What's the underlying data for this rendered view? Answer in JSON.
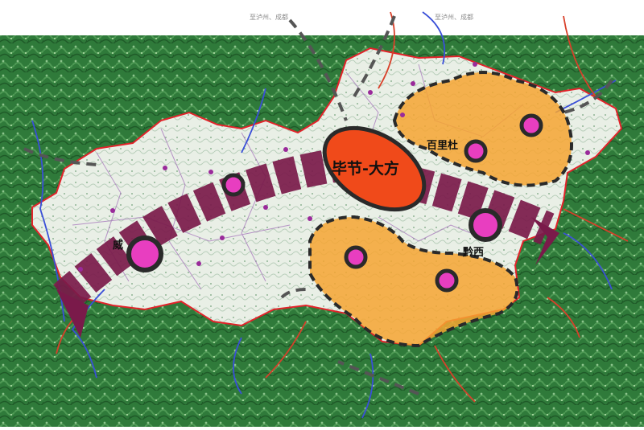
{
  "map": {
    "top_labels": {
      "left": "至泸州、成都",
      "right": "至泸州、成都"
    },
    "core_label": "毕节-大方",
    "city_labels": {
      "baili": "百里杜",
      "qianxi": "黔西",
      "west": "威"
    },
    "colors": {
      "background_top": "#ffffff",
      "terrain": "#2f7a3a",
      "region_fill": "#f2f4ef",
      "boundary": "#e2232a",
      "axis_band": "#7a1a4a",
      "core_zone": "#f04a1a",
      "node_pink": "#e83ec0",
      "node_ring": "#2a2a2a",
      "orange_zone": "#f6a531",
      "dashed_line": "#555555",
      "river_blue": "#3a4fd8",
      "road_red": "#d8402a"
    }
  }
}
